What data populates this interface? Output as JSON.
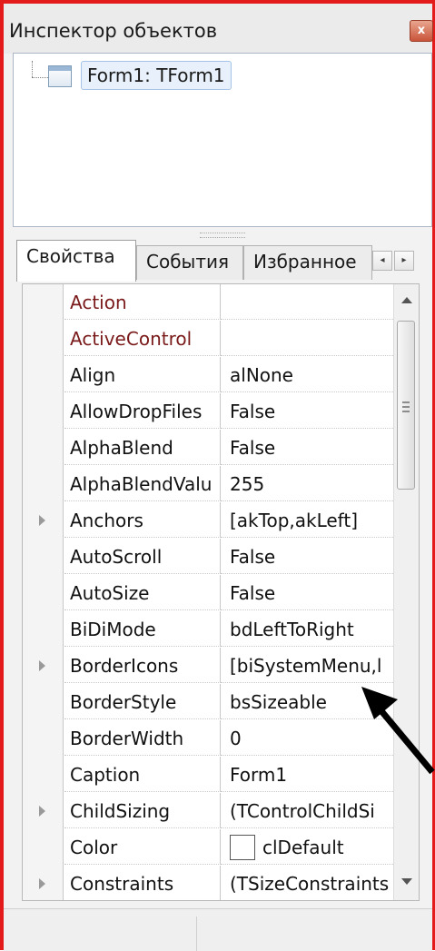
{
  "window": {
    "title": "Инспектор объектов",
    "close_label": "x"
  },
  "tree": {
    "root": "Form1: TForm1"
  },
  "tabs": [
    {
      "label": "Свойства",
      "active": true
    },
    {
      "label": "События",
      "active": false
    },
    {
      "label": "Избранное",
      "active": false
    }
  ],
  "tab_scroll": {
    "left": "◂",
    "right": "▸"
  },
  "properties": [
    {
      "name": "Action",
      "value": "",
      "event": true,
      "expandable": false
    },
    {
      "name": "ActiveControl",
      "value": "",
      "event": true,
      "expandable": false
    },
    {
      "name": "Align",
      "value": "alNone",
      "event": false,
      "expandable": false
    },
    {
      "name": "AllowDropFiles",
      "value": "False",
      "event": false,
      "expandable": false
    },
    {
      "name": "AlphaBlend",
      "value": "False",
      "event": false,
      "expandable": false
    },
    {
      "name": "AlphaBlendValu",
      "value": "255",
      "event": false,
      "expandable": false
    },
    {
      "name": "Anchors",
      "value": "[akTop,akLeft]",
      "event": false,
      "expandable": true
    },
    {
      "name": "AutoScroll",
      "value": "False",
      "event": false,
      "expandable": false
    },
    {
      "name": "AutoSize",
      "value": "False",
      "event": false,
      "expandable": false
    },
    {
      "name": "BiDiMode",
      "value": "bdLeftToRight",
      "event": false,
      "expandable": false
    },
    {
      "name": "BorderIcons",
      "value": "[biSystemMenu,l",
      "event": false,
      "expandable": true
    },
    {
      "name": "BorderStyle",
      "value": "bsSizeable",
      "event": false,
      "expandable": false
    },
    {
      "name": "BorderWidth",
      "value": "0",
      "event": false,
      "expandable": false
    },
    {
      "name": "Caption",
      "value": "Form1",
      "event": false,
      "expandable": false
    },
    {
      "name": "ChildSizing",
      "value": "(TControlChildSi",
      "event": false,
      "expandable": true
    },
    {
      "name": "Color",
      "value": "clDefault",
      "event": false,
      "expandable": false,
      "swatch": true
    },
    {
      "name": "Constraints",
      "value": "(TSizeConstraints",
      "event": false,
      "expandable": true
    }
  ],
  "colors": {
    "frame_border": "#e31b1b",
    "event_text": "#7a1a1a",
    "arrow": "#000000"
  }
}
